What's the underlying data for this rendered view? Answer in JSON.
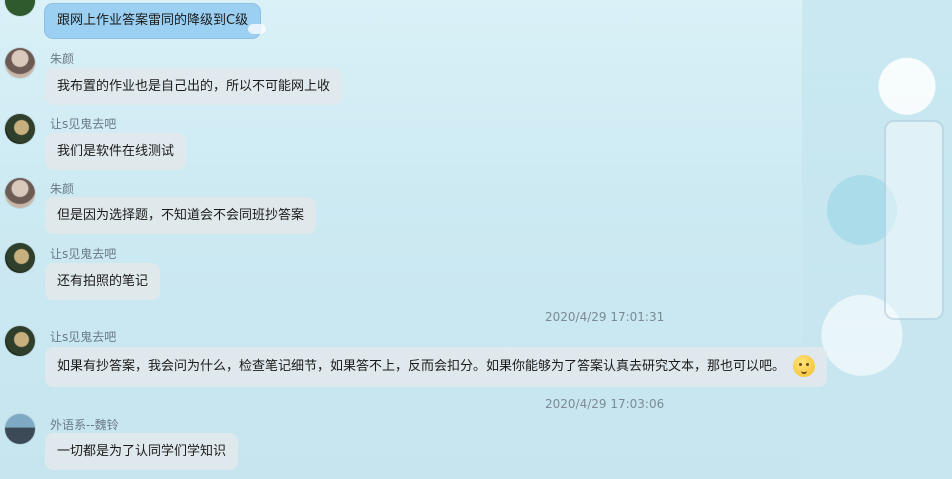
{
  "messages": [
    {
      "type": "self",
      "text": "跟网上作业答案雷同的降级到C级"
    },
    {
      "type": "other",
      "name": "朱颜",
      "text": "我布置的作业也是自己出的，所以不可能网上收"
    },
    {
      "type": "other",
      "name": "让s见鬼去吧",
      "text": "我们是软件在线测试"
    },
    {
      "type": "other",
      "name": "朱颜",
      "text": "但是因为选择题，不知道会不会同班抄答案"
    },
    {
      "type": "other",
      "name": "让s见鬼去吧",
      "text": "还有拍照的笔记"
    },
    {
      "type": "time",
      "text": "2020/4/29 17:01:31"
    },
    {
      "type": "other",
      "name": "让s见鬼去吧",
      "text": "如果有抄答案，我会问为什么，检查笔记细节，如果答不上，反而会扣分。如果你能够为了答案认真去研究文本，那也可以吧。",
      "emoji": "thinking-face-icon"
    },
    {
      "type": "time",
      "text": "2020/4/29 17:03:06"
    },
    {
      "type": "other",
      "name": "外语系--魏铃",
      "text": "一切都是为了认同学们学知识"
    }
  ]
}
